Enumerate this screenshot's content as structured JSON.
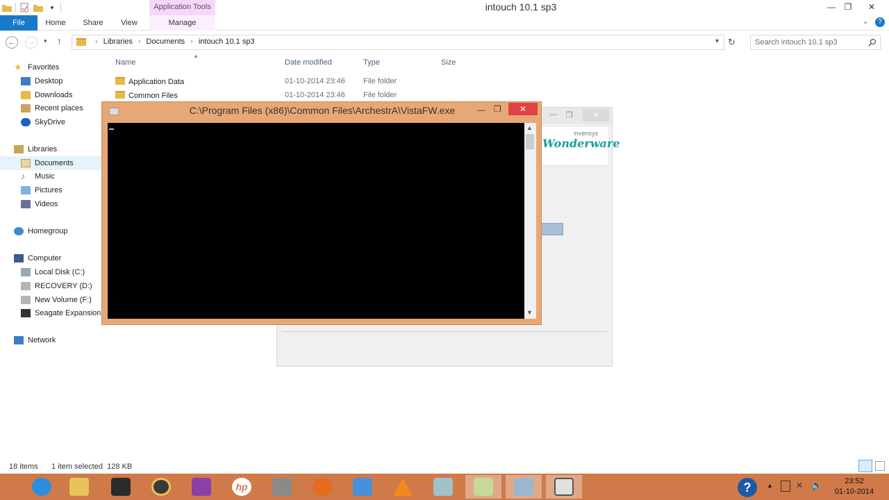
{
  "window": {
    "title": "intouch 10.1 sp3",
    "contextual_group": "Application Tools"
  },
  "ribbon": {
    "tabs": [
      "File",
      "Home",
      "Share",
      "View",
      "Manage"
    ]
  },
  "address": {
    "crumbs": [
      "Libraries",
      "Documents",
      "intouch 10.1 sp3"
    ],
    "search_placeholder": "Search intouch 10.1 sp3"
  },
  "nav": {
    "favorites": "Favorites",
    "favorites_items": [
      "Desktop",
      "Downloads",
      "Recent places",
      "SkyDrive"
    ],
    "libraries": "Libraries",
    "libraries_items": [
      "Documents",
      "Music",
      "Pictures",
      "Videos"
    ],
    "homegroup": "Homegroup",
    "computer": "Computer",
    "computer_items": [
      "Local Disk (C:)",
      "RECOVERY (D:)",
      "New Volume (F:)",
      "Seagate Expansion D"
    ],
    "network": "Network"
  },
  "columns": {
    "name": "Name",
    "date": "Date modified",
    "type": "Type",
    "size": "Size"
  },
  "files": [
    {
      "name": "Application Data",
      "date": "01-10-2014 23:46",
      "type": "File folder"
    },
    {
      "name": "Common Files",
      "date": "01-10-2014 23:46",
      "type": "File folder"
    }
  ],
  "console": {
    "title": "C:\\Program Files (x86)\\Common Files\\ArchestrA\\VistaFW.exe"
  },
  "installer": {
    "brand_small": "invensys",
    "brand_logo": "Wonderware"
  },
  "status": {
    "items_count": "18 items",
    "selection": "1 item selected  128 KB"
  },
  "clock": {
    "time": "23:52",
    "date": "01-10-2014"
  },
  "colors": {
    "file_tab": "#1979ca",
    "console_frame": "#e8a876",
    "taskbar": "#d07a4a",
    "close_button": "#e04343"
  }
}
